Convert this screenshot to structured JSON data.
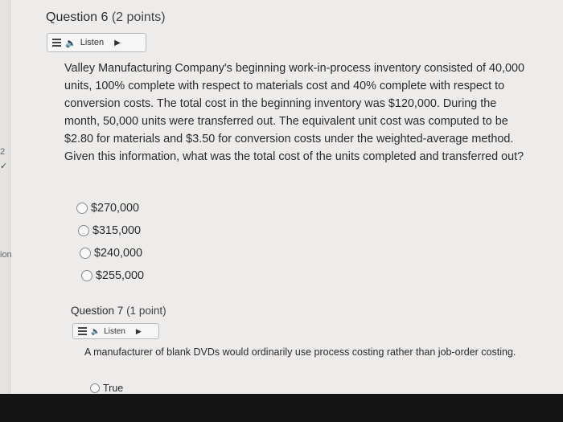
{
  "side": {
    "num": "2",
    "mark": "✓",
    "label": "ion"
  },
  "q6": {
    "title": "Question 6",
    "points": "(2 points)",
    "listen": "Listen",
    "text": "Valley Manufacturing Company's beginning work-in-process inventory consisted of 40,000 units, 100% complete with respect to materials cost and 40% complete with respect to conversion costs. The total cost in the beginning inventory was $120,000. During the month, 50,000 units were transferred out. The equivalent unit cost was computed to be $2.80 for materials and $3.50 for conversion costs under the weighted-average method. Given this information, what was the total cost of the units completed and transferred out?",
    "options": [
      "$270,000",
      "$315,000",
      "$240,000",
      "$255,000"
    ]
  },
  "q7": {
    "title": "Question 7",
    "points": "(1 point)",
    "listen": "Listen",
    "text": "A manufacturer of blank DVDs would ordinarily use process costing rather than job-order costing.",
    "options": [
      "True"
    ]
  },
  "icons": {
    "menu": "menu-icon",
    "speaker": "speaker-icon",
    "play": "play-icon"
  }
}
